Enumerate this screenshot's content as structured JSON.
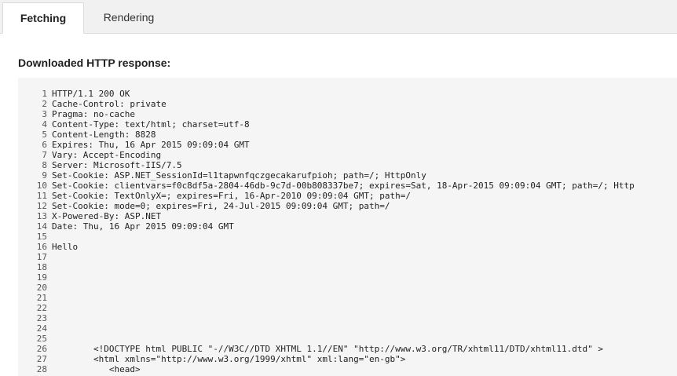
{
  "tabs": [
    {
      "label": "Fetching",
      "active": true
    },
    {
      "label": "Rendering",
      "active": false
    }
  ],
  "section_title": "Downloaded HTTP response:",
  "code_lines": [
    {
      "num": "1",
      "text": "HTTP/1.1 200 OK"
    },
    {
      "num": "2",
      "text": "Cache-Control: private"
    },
    {
      "num": "3",
      "text": "Pragma: no-cache"
    },
    {
      "num": "4",
      "text": "Content-Type: text/html; charset=utf-8"
    },
    {
      "num": "5",
      "text": "Content-Length: 8828"
    },
    {
      "num": "6",
      "text": "Expires: Thu, 16 Apr 2015 09:09:04 GMT"
    },
    {
      "num": "7",
      "text": "Vary: Accept-Encoding"
    },
    {
      "num": "8",
      "text": "Server: Microsoft-IIS/7.5"
    },
    {
      "num": "9",
      "text": "Set-Cookie: ASP.NET_SessionId=l1tapwnfqczgecakarufpioh; path=/; HttpOnly"
    },
    {
      "num": "10",
      "text": "Set-Cookie: clientvars=f0c8df5a-2804-46db-9c7d-00b808337be7; expires=Sat, 18-Apr-2015 09:09:04 GMT; path=/; Http"
    },
    {
      "num": "11",
      "text": "Set-Cookie: TextOnlyX=; expires=Fri, 16-Apr-2010 09:09:04 GMT; path=/"
    },
    {
      "num": "12",
      "text": "Set-Cookie: mode=0; expires=Fri, 24-Jul-2015 09:09:04 GMT; path=/"
    },
    {
      "num": "13",
      "text": "X-Powered-By: ASP.NET"
    },
    {
      "num": "14",
      "text": "Date: Thu, 16 Apr 2015 09:09:04 GMT"
    },
    {
      "num": "15",
      "text": ""
    },
    {
      "num": "16",
      "text": "Hello"
    },
    {
      "num": "17",
      "text": ""
    },
    {
      "num": "18",
      "text": ""
    },
    {
      "num": "19",
      "text": ""
    },
    {
      "num": "20",
      "text": ""
    },
    {
      "num": "21",
      "text": ""
    },
    {
      "num": "22",
      "text": ""
    },
    {
      "num": "23",
      "text": ""
    },
    {
      "num": "24",
      "text": ""
    },
    {
      "num": "25",
      "text": ""
    },
    {
      "num": "26",
      "text": "        <!DOCTYPE html PUBLIC \"-//W3C//DTD XHTML 1.1//EN\" \"http://www.w3.org/TR/xhtml11/DTD/xhtml11.dtd\" >"
    },
    {
      "num": "27",
      "text": "        <html xmlns=\"http://www.w3.org/1999/xhtml\" xml:lang=\"en-gb\">"
    },
    {
      "num": "28",
      "text": "           <head>"
    }
  ]
}
